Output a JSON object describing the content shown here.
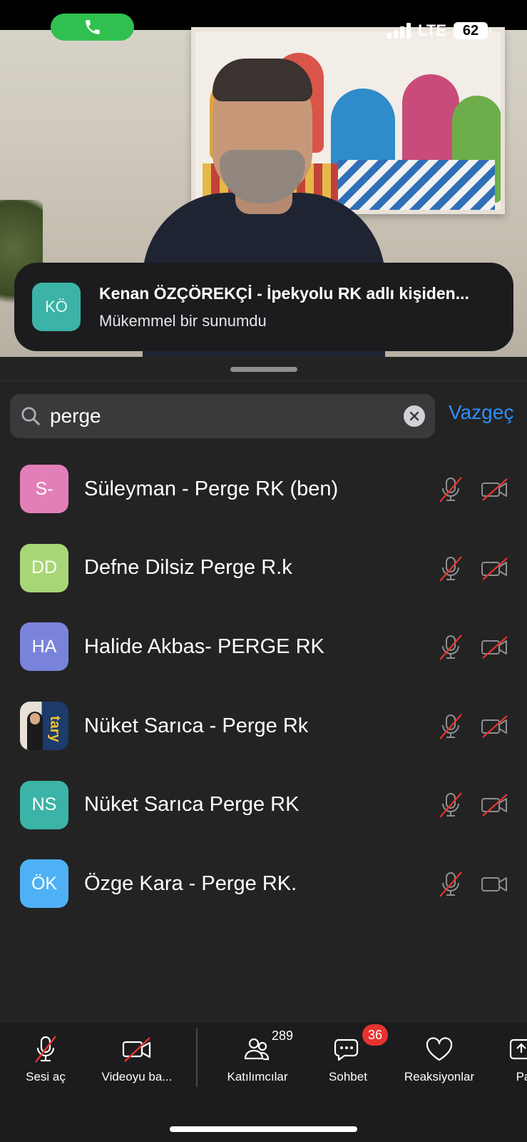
{
  "status_bar": {
    "network": "LTE",
    "battery": "62",
    "call_icon": "phone-icon"
  },
  "notification": {
    "avatar_initials": "KÖ",
    "title": "Kenan ÖZÇÖREKÇİ - İpekyolu RK adlı kişiden...",
    "message": "Mükemmel bir sunumdu"
  },
  "search": {
    "query": "perge",
    "cancel_label": "Vazgeç"
  },
  "participants": [
    {
      "initials": "S-",
      "name": "Süleyman - Perge RK (ben)",
      "color": "#e37fb8",
      "mic_muted": true,
      "video_off": true
    },
    {
      "initials": "DD",
      "name": "Defne Dilsiz Perge R.k",
      "color": "#a8d676",
      "mic_muted": true,
      "video_off": true
    },
    {
      "initials": "HA",
      "name": "Halide Akbas- PERGE RK",
      "color": "#7a83db",
      "mic_muted": true,
      "video_off": true
    },
    {
      "initials": "",
      "name": "Nüket Sarıca - Perge Rk",
      "color": "#1d3b6b",
      "mic_muted": true,
      "video_off": true,
      "photo": true,
      "photo_text": "tary"
    },
    {
      "initials": "NS",
      "name": "Nüket Sarıca Perge RK",
      "color": "#3bb3a6",
      "mic_muted": true,
      "video_off": true
    },
    {
      "initials": "ÖK",
      "name": "Özge Kara - Perge RK.",
      "color": "#4fb1f5",
      "mic_muted": true,
      "video_off": false
    }
  ],
  "toolbar": {
    "unmute_label": "Sesi aç",
    "video_label": "Videoyu ba...",
    "participants_label": "Katılımcılar",
    "participants_count": "289",
    "chat_label": "Sohbet",
    "chat_badge": "36",
    "reactions_label": "Reaksiyonlar",
    "more_label": "Pa"
  }
}
